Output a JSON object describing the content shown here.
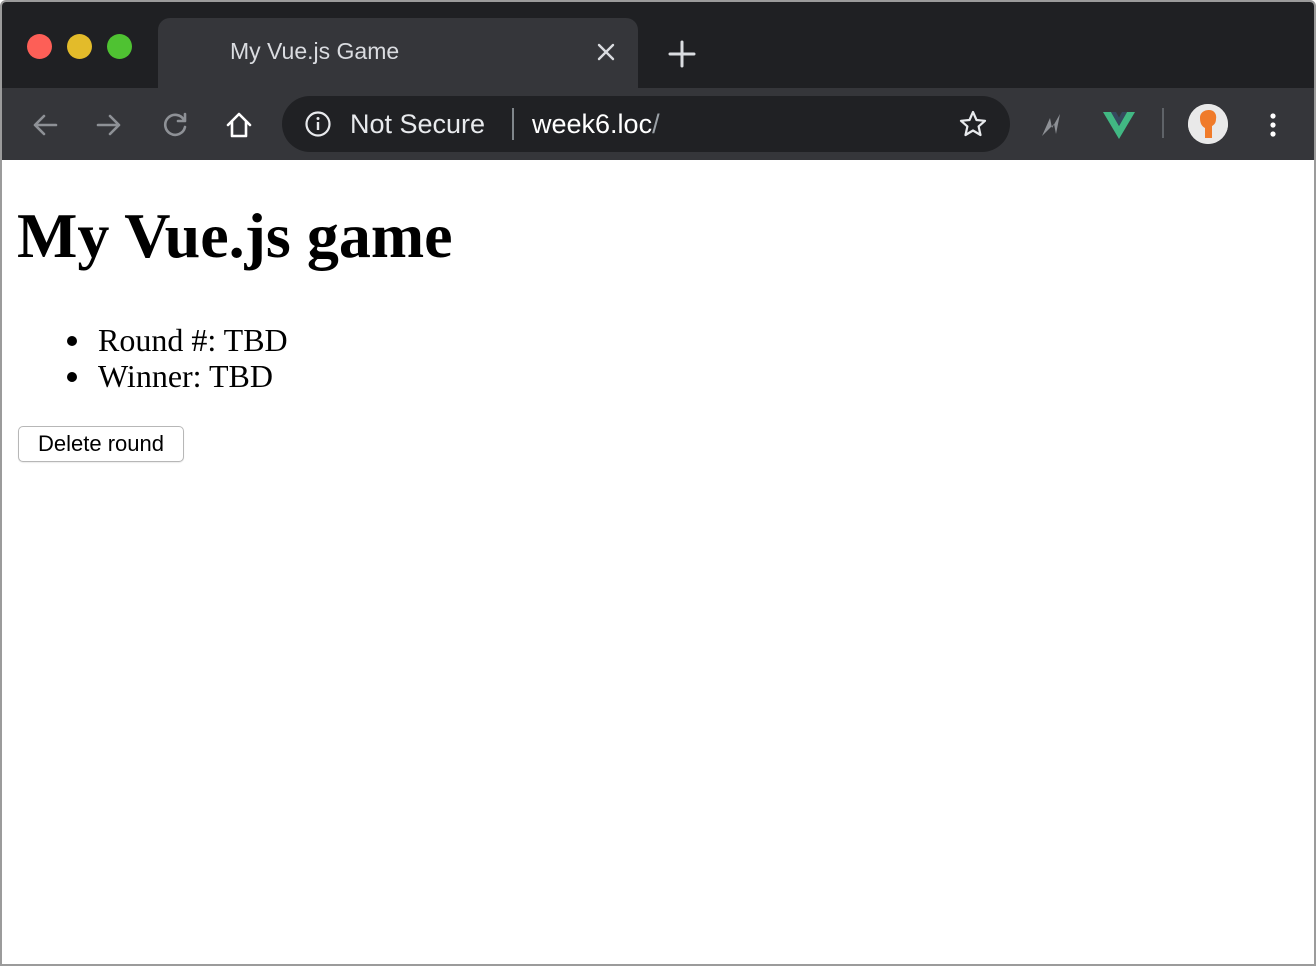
{
  "tab": {
    "title": "My Vue.js Game"
  },
  "omnibox": {
    "security_label": "Not Secure",
    "url_host": "week6.loc",
    "url_path": "/"
  },
  "colors": {
    "chrome_frame": "#1f2023",
    "chrome_toolbar": "#35363a",
    "omnibox_bg": "#202124",
    "vue_green": "#41b883",
    "avatar_orange": "#f07b2a"
  },
  "icons": {
    "toolbar": [
      "back-arrow-icon",
      "forward-arrow-icon",
      "reload-icon",
      "home-icon"
    ],
    "omnibox": [
      "info-icon",
      "star-icon"
    ],
    "extensions": [
      "lightning-extension-icon",
      "vue-devtools-icon"
    ]
  },
  "page": {
    "heading": "My Vue.js game",
    "round_label": "Round #: TBD",
    "winner_label": "Winner: TBD",
    "delete_button": "Delete round"
  }
}
